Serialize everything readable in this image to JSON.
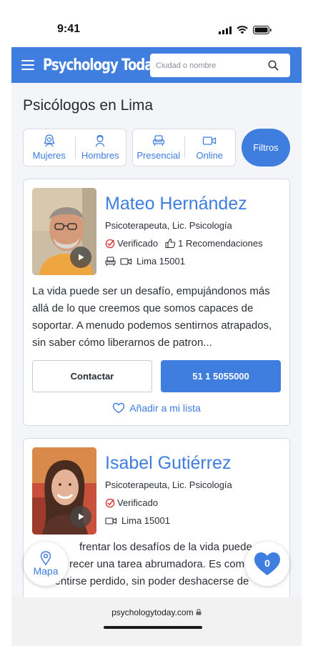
{
  "status_bar": {
    "time": "9:41"
  },
  "header": {
    "logo_text": "Psychology Today",
    "search": {
      "placeholder": "Ciudad o nombre",
      "value": ""
    }
  },
  "page": {
    "title": "Psicólogos en Lima",
    "filters": [
      {
        "label": "Mujeres",
        "icon": "female-icon"
      },
      {
        "label": "Hombres",
        "icon": "male-icon"
      },
      {
        "label": "Presencial",
        "icon": "armchair-icon"
      },
      {
        "label": "Online",
        "icon": "video-icon"
      }
    ],
    "filters_button": "Filtros"
  },
  "profiles": [
    {
      "name": "Mateo Hernández",
      "credentials": "Psicoterapeuta, Lic. Psicología",
      "verified": "Verificado",
      "recommendations": "1 Recomendaciones",
      "location": "Lima 15001",
      "bio": "La vida puede ser un desafío, empujándonos más allá de lo que creemos que somos capaces de soportar. A menudo podemos sentirnos atrapados, sin saber cómo liberarnos de patron...",
      "contact_label": "Contactar",
      "phone": "51 1 5055000",
      "add_list_label": "Añadir a mi lista"
    },
    {
      "name": "Isabel Gutiérrez",
      "credentials": "Psicoterapeuta, Lic. Psicología",
      "verified": "Verificado",
      "location": "Lima 15001",
      "bio_lines": [
        "frentar los desafíos de la vida puede",
        "recer una tarea abrumadora. Es com",
        "sentirse perdido, sin poder deshacerse de"
      ]
    }
  ],
  "floating": {
    "map_label": "Mapa",
    "favorites_count": "0"
  },
  "browser": {
    "url": "psychologytoday.com"
  },
  "colors": {
    "brand_blue": "#3f7ddf",
    "background": "#f3f5f8",
    "verified_red": "#d93b3b"
  }
}
